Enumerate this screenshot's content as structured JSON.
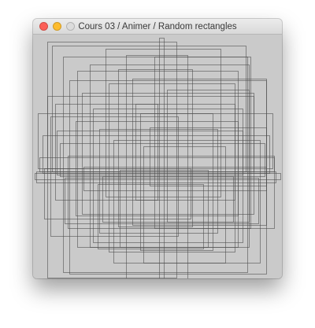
{
  "window": {
    "title": "Cours 03 / Animer / Random rectangles",
    "controls": {
      "close_color": "#fc5f57",
      "minimize_color": "#fdbc2e",
      "maximize_color": "#dcdcdc"
    }
  },
  "canvas": {
    "background": "#cacaca",
    "stroke_color": "#505050",
    "drawing": "random rectangles"
  }
}
